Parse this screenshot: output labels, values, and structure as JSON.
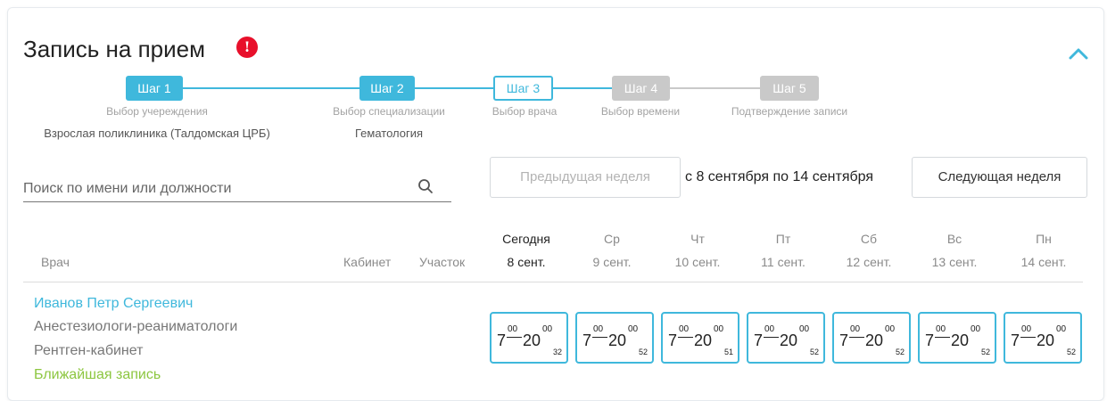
{
  "header": {
    "title": "Запись на прием",
    "info_icon": "!",
    "accent_color": "#3fb8dc",
    "alert_color": "#e8102b"
  },
  "steps": [
    {
      "label": "Шаг 1",
      "caption": "Выбор учереждения",
      "value": "Взрослая поликлиника (Талдомская ЦРБ)",
      "state": "done"
    },
    {
      "label": "Шаг 2",
      "caption": "Выбор специализации",
      "value": "Гематология",
      "state": "done"
    },
    {
      "label": "Шаг 3",
      "caption": "Выбор врача",
      "value": "",
      "state": "active"
    },
    {
      "label": "Шаг 4",
      "caption": "Выбор времени",
      "value": "",
      "state": "todo"
    },
    {
      "label": "Шаг 5",
      "caption": "Подтверждение записи",
      "value": "",
      "state": "todo"
    }
  ],
  "search": {
    "placeholder": "Поиск по имени или должности",
    "icon": "search-icon"
  },
  "week": {
    "prev_label": "Предыдущая неделя",
    "range_text": "с 8 сентября по 14 сентября",
    "next_label": "Следующая неделя"
  },
  "table": {
    "col_doctor": "Врач",
    "col_cabinet": "Кабинет",
    "col_district": "Участок",
    "days": [
      {
        "name": "Сегодня",
        "date": "8 сент."
      },
      {
        "name": "Ср",
        "date": "9 сент."
      },
      {
        "name": "Чт",
        "date": "10 сент."
      },
      {
        "name": "Пт",
        "date": "11 сент."
      },
      {
        "name": "Сб",
        "date": "12 сент."
      },
      {
        "name": "Вс",
        "date": "13 сент."
      },
      {
        "name": "Пн",
        "date": "14 сент."
      }
    ]
  },
  "doctor": {
    "name": "Иванов Петр Сергеевич",
    "specialty": "Анестезиологи-реаниматологи",
    "room": "Рентген-кабинет",
    "nearest_label": "Ближайшая запись",
    "slots": [
      {
        "from_h": "7",
        "from_m": "00",
        "to_h": "20",
        "to_m": "00",
        "count": "32"
      },
      {
        "from_h": "7",
        "from_m": "00",
        "to_h": "20",
        "to_m": "00",
        "count": "52"
      },
      {
        "from_h": "7",
        "from_m": "00",
        "to_h": "20",
        "to_m": "00",
        "count": "51"
      },
      {
        "from_h": "7",
        "from_m": "00",
        "to_h": "20",
        "to_m": "00",
        "count": "52"
      },
      {
        "from_h": "7",
        "from_m": "00",
        "to_h": "20",
        "to_m": "00",
        "count": "52"
      },
      {
        "from_h": "7",
        "from_m": "00",
        "to_h": "20",
        "to_m": "00",
        "count": "52"
      },
      {
        "from_h": "7",
        "from_m": "00",
        "to_h": "20",
        "to_m": "00",
        "count": "52"
      }
    ]
  }
}
